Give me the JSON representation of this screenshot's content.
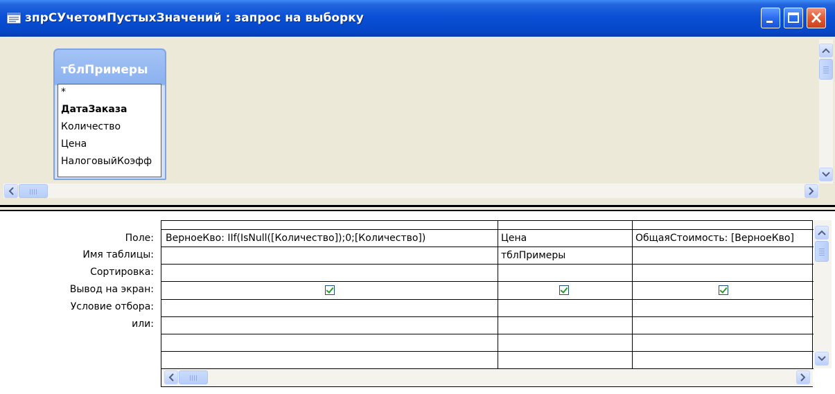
{
  "window": {
    "title": "зпрСУчетомПустыхЗначений : запрос на выборку"
  },
  "design": {
    "table_caption": "тблПримеры",
    "fields": [
      "*",
      "ДатаЗаказа",
      "Количество",
      "Цена",
      "НалоговыйКоэфф"
    ]
  },
  "grid": {
    "row_labels": [
      "Поле:",
      "Имя таблицы:",
      "Сортировка:",
      "Вывод на экран:",
      "Условие отбора:",
      "или:"
    ],
    "columns": [
      {
        "field": "ВерноеКво: IIf(IsNull([Количество]);0;[Количество])",
        "table": "",
        "show": true
      },
      {
        "field": "Цена",
        "table": "тблПримеры",
        "show": true
      },
      {
        "field": "ОбщаяСтоимость: [ВерноеКво]",
        "table": "",
        "show": true
      }
    ]
  },
  "colors": {
    "titlebar": "#0a4fd6",
    "close_button": "#e25a32",
    "table_caption_bg": "#8ab1ef",
    "check_green": "#21a121"
  },
  "icons": {
    "title": "query-icon",
    "minimize": "minimize-icon",
    "maximize": "maximize-icon",
    "close": "close-icon"
  }
}
